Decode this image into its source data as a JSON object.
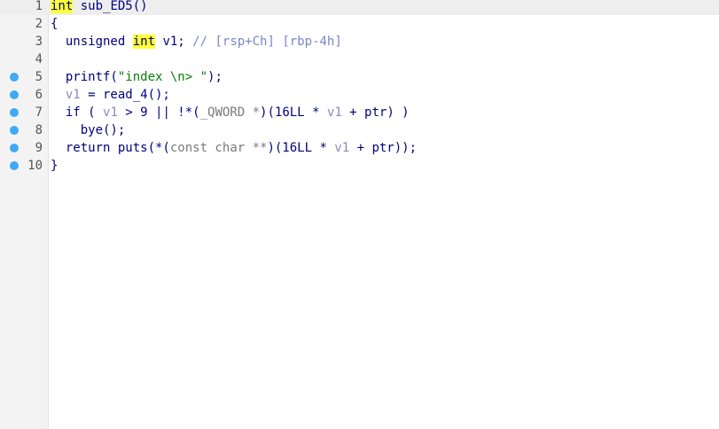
{
  "code": {
    "line_numbers": [
      "1",
      "2",
      "3",
      "4",
      "5",
      "6",
      "7",
      "8",
      "9",
      "10"
    ],
    "line1": {
      "kw": "int",
      "rest": " sub_ED5()"
    },
    "line2": {
      "text": "{"
    },
    "line3": {
      "pre": "  unsigned ",
      "kw": "int",
      "mid": " v1; ",
      "comment": "// [rsp+Ch] [rbp-4h]"
    },
    "line4": {
      "text": ""
    },
    "line5": {
      "pre": "  printf(",
      "str": "\"index \\n> \"",
      "post": ");"
    },
    "line6": {
      "pre": "  ",
      "var": "v1",
      "post": " = read_4();"
    },
    "line7": {
      "pre": "  if ( ",
      "var1": "v1",
      "mid1": " > 9 || !*(",
      "type": "_QWORD *",
      "mid2": ")(16LL * ",
      "var2": "v1",
      "post": " + ptr) )"
    },
    "line8": {
      "text": "    bye();"
    },
    "line9": {
      "pre": "  return puts(*(",
      "type": "const char **",
      "mid": ")(16LL * ",
      "var": "v1",
      "post": " + ptr));"
    },
    "line10": {
      "text": "}"
    }
  },
  "colors": {
    "keyword_highlight": "#ffff33",
    "breakpoint_dot": "#3fa9f5",
    "code_text": "#000080",
    "string": "#0a7d0a",
    "comment": "#7a86c8"
  }
}
